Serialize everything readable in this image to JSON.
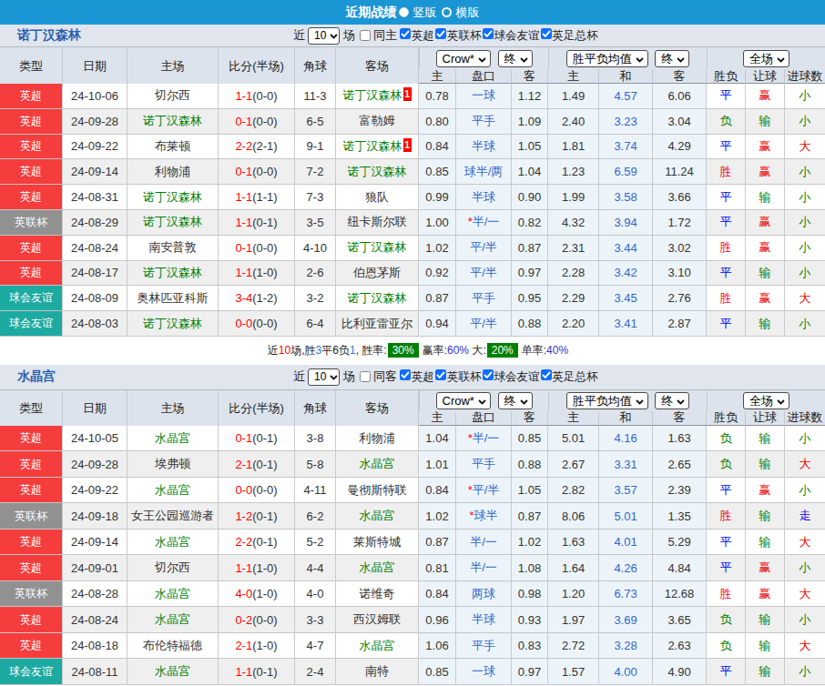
{
  "topbar": {
    "title": "近期战绩",
    "options": [
      {
        "label": "竖版",
        "selected": true
      },
      {
        "label": "横版",
        "selected": false
      }
    ]
  },
  "palette": {
    "topbar_blue": "#1b96d4",
    "league_red": "#f53d3d",
    "league_gray": "#919191",
    "league_teal": "#1caaa1",
    "focus_team_green": "#008000",
    "score_red": "#ff0000",
    "handicap_blue": "#3366cc",
    "summary_badge_green": "#008000"
  },
  "result_color_map": {
    "胜": "r",
    "赢": "r",
    "大": "r",
    "平": "b",
    "走": "b",
    "负": "g",
    "输": "g",
    "小": "g"
  },
  "league_bg_map": {
    "英超": "red",
    "英联杯": "gray",
    "球会友谊": "teal",
    "英足总杯": "teal"
  },
  "tables": [
    {
      "team": "诺丁汉森林",
      "filter": {
        "prefix": "近",
        "count": "10",
        "suffix": "场",
        "same_label": "同主",
        "same_checked": false,
        "leagues": [
          {
            "label": "英超",
            "checked": true
          },
          {
            "label": "英联杯",
            "checked": true
          },
          {
            "label": "球会友谊",
            "checked": true
          },
          {
            "label": "英足总杯",
            "checked": true
          }
        ]
      },
      "selects": {
        "company": "Crow*",
        "company_state": "终",
        "europe": "胜平负均值",
        "europe_state": "终",
        "scope": "全场"
      },
      "columns": [
        "类型",
        "日期",
        "主场",
        "比分(半场)",
        "角球",
        "客场",
        "主",
        "盘口",
        "客",
        "主",
        "和",
        "客",
        "胜负",
        "让球",
        "进球数"
      ],
      "rows": [
        {
          "comp": "英超",
          "date": "24-10-06",
          "home": "切尔西",
          "score": "1-1",
          "half": "(0-0)",
          "corner": "11-3",
          "away": "诺丁汉森林",
          "away_badge": "1",
          "ah": [
            "0.78",
            "一球",
            "1.12"
          ],
          "eu": [
            "1.49",
            "4.57",
            "6.06"
          ],
          "res": [
            "平",
            "赢",
            "小"
          ]
        },
        {
          "comp": "英超",
          "date": "24-09-28",
          "home": "诺丁汉森林",
          "score": "0-1",
          "half": "(0-0)",
          "corner": "6-5",
          "away": "富勒姆",
          "ah": [
            "0.80",
            "平手",
            "1.09"
          ],
          "eu": [
            "2.40",
            "3.23",
            "3.04"
          ],
          "res": [
            "负",
            "输",
            "小"
          ]
        },
        {
          "comp": "英超",
          "date": "24-09-22",
          "home": "布莱顿",
          "score": "2-2",
          "half": "(2-1)",
          "corner": "9-1",
          "away": "诺丁汉森林",
          "away_badge": "1",
          "ah": [
            "0.84",
            "半球",
            "1.05"
          ],
          "eu": [
            "1.81",
            "3.74",
            "4.29"
          ],
          "res": [
            "平",
            "赢",
            "大"
          ]
        },
        {
          "comp": "英超",
          "date": "24-09-14",
          "home": "利物浦",
          "score": "0-1",
          "half": "(0-0)",
          "corner": "7-2",
          "away": "诺丁汉森林",
          "ah": [
            "0.85",
            "球半/两",
            "1.04"
          ],
          "eu": [
            "1.23",
            "6.59",
            "11.24"
          ],
          "res": [
            "胜",
            "赢",
            "小"
          ]
        },
        {
          "comp": "英超",
          "date": "24-08-31",
          "home": "诺丁汉森林",
          "score": "1-1",
          "half": "(1-1)",
          "corner": "7-3",
          "away": "狼队",
          "ah": [
            "0.99",
            "半球",
            "0.90"
          ],
          "eu": [
            "1.99",
            "3.58",
            "3.66"
          ],
          "res": [
            "平",
            "输",
            "小"
          ]
        },
        {
          "comp": "英联杯",
          "date": "24-08-29",
          "home": "诺丁汉森林",
          "score": "1-1",
          "half": "(0-1)",
          "corner": "3-5",
          "away": "纽卡斯尔联",
          "ah": [
            "1.00",
            "*半/一",
            "0.82"
          ],
          "eu": [
            "4.32",
            "3.94",
            "1.72"
          ],
          "res": [
            "平",
            "赢",
            "小"
          ]
        },
        {
          "comp": "英超",
          "date": "24-08-24",
          "home": "南安普敦",
          "score": "0-1",
          "half": "(0-0)",
          "corner": "4-10",
          "away": "诺丁汉森林",
          "ah": [
            "1.02",
            "平/半",
            "0.87"
          ],
          "eu": [
            "2.31",
            "3.44",
            "3.02"
          ],
          "res": [
            "胜",
            "赢",
            "小"
          ]
        },
        {
          "comp": "英超",
          "date": "24-08-17",
          "home": "诺丁汉森林",
          "score": "1-1",
          "half": "(1-0)",
          "corner": "2-6",
          "away": "伯恩茅斯",
          "ah": [
            "0.92",
            "平/半",
            "0.97"
          ],
          "eu": [
            "2.28",
            "3.42",
            "3.10"
          ],
          "res": [
            "平",
            "输",
            "小"
          ]
        },
        {
          "comp": "球会友谊",
          "date": "24-08-09",
          "home": "奥林匹亚科斯",
          "score": "3-4",
          "half": "(1-2)",
          "corner": "3-2",
          "away": "诺丁汉森林",
          "ah": [
            "0.87",
            "平手",
            "0.95"
          ],
          "eu": [
            "2.29",
            "3.45",
            "2.76"
          ],
          "res": [
            "胜",
            "赢",
            "大"
          ]
        },
        {
          "comp": "球会友谊",
          "date": "24-08-03",
          "home": "诺丁汉森林",
          "score": "0-0",
          "half": "(0-0)",
          "corner": "6-4",
          "away": "比利亚雷亚尔",
          "ah": [
            "0.94",
            "平/半",
            "0.88"
          ],
          "eu": [
            "2.20",
            "3.41",
            "2.87"
          ],
          "res": [
            "平",
            "输",
            "小"
          ]
        }
      ],
      "summary": [
        {
          "text": "近"
        },
        {
          "text": "10",
          "style": "red"
        },
        {
          "text": "场,胜"
        },
        {
          "text": "3",
          "style": "blue"
        },
        {
          "text": "平"
        },
        {
          "text": "6"
        },
        {
          "text": "负"
        },
        {
          "text": "1",
          "style": "blue"
        },
        {
          "text": ", 胜率:"
        },
        {
          "text": "30%",
          "style": "badge"
        },
        {
          "text": "赢率:"
        },
        {
          "text": "60%",
          "style": "pct"
        },
        {
          "text": " 大:"
        },
        {
          "text": "20%",
          "style": "badge"
        },
        {
          "text": "单率:"
        },
        {
          "text": "40%",
          "style": "pct"
        }
      ]
    },
    {
      "team": "水晶宫",
      "filter": {
        "prefix": "近",
        "count": "10",
        "suffix": "场",
        "same_label": "同客",
        "same_checked": false,
        "leagues": [
          {
            "label": "英超",
            "checked": true
          },
          {
            "label": "英联杯",
            "checked": true
          },
          {
            "label": "球会友谊",
            "checked": true
          },
          {
            "label": "英足总杯",
            "checked": true
          }
        ]
      },
      "selects": {
        "company": "Crow*",
        "company_state": "终",
        "europe": "胜平负均值",
        "europe_state": "终",
        "scope": "全场"
      },
      "columns": [
        "类型",
        "日期",
        "主场",
        "比分(半场)",
        "角球",
        "客场",
        "主",
        "盘口",
        "客",
        "主",
        "和",
        "客",
        "胜负",
        "让球",
        "进球数"
      ],
      "rows": [
        {
          "comp": "英超",
          "date": "24-10-05",
          "home": "水晶宫",
          "score": "0-1",
          "half": "(0-1)",
          "corner": "3-8",
          "away": "利物浦",
          "ah": [
            "1.04",
            "*半/一",
            "0.85"
          ],
          "eu": [
            "5.01",
            "4.16",
            "1.63"
          ],
          "res": [
            "负",
            "输",
            "小"
          ]
        },
        {
          "comp": "英超",
          "date": "24-09-28",
          "home": "埃弗顿",
          "score": "2-1",
          "half": "(0-1)",
          "corner": "5-8",
          "away": "水晶宫",
          "ah": [
            "1.01",
            "平手",
            "0.88"
          ],
          "eu": [
            "2.67",
            "3.31",
            "2.65"
          ],
          "res": [
            "负",
            "输",
            "大"
          ]
        },
        {
          "comp": "英超",
          "date": "24-09-22",
          "home": "水晶宫",
          "score": "0-0",
          "half": "(0-0)",
          "corner": "4-11",
          "away": "曼彻斯特联",
          "ah": [
            "0.84",
            "*平/半",
            "1.05"
          ],
          "eu": [
            "2.82",
            "3.57",
            "2.39"
          ],
          "res": [
            "平",
            "赢",
            "小"
          ]
        },
        {
          "comp": "英联杯",
          "date": "24-09-18",
          "home": "女王公园巡游者",
          "score": "1-2",
          "half": "(0-1)",
          "corner": "6-2",
          "away": "水晶宫",
          "ah": [
            "1.02",
            "*球半",
            "0.87"
          ],
          "eu": [
            "8.06",
            "5.01",
            "1.35"
          ],
          "res": [
            "胜",
            "输",
            "走"
          ]
        },
        {
          "comp": "英超",
          "date": "24-09-14",
          "home": "水晶宫",
          "score": "2-2",
          "half": "(0-1)",
          "corner": "5-2",
          "away": "莱斯特城",
          "ah": [
            "0.87",
            "半/一",
            "1.02"
          ],
          "eu": [
            "1.63",
            "4.01",
            "5.29"
          ],
          "res": [
            "平",
            "输",
            "大"
          ]
        },
        {
          "comp": "英超",
          "date": "24-09-01",
          "home": "切尔西",
          "score": "1-1",
          "half": "(1-0)",
          "corner": "4-4",
          "away": "水晶宫",
          "ah": [
            "0.81",
            "半/一",
            "1.08"
          ],
          "eu": [
            "1.64",
            "4.26",
            "4.84"
          ],
          "res": [
            "平",
            "赢",
            "小"
          ]
        },
        {
          "comp": "英联杯",
          "date": "24-08-28",
          "home": "水晶宫",
          "score": "4-0",
          "half": "(1-0)",
          "corner": "4-0",
          "away": "诺维奇",
          "ah": [
            "0.84",
            "两球",
            "0.98"
          ],
          "eu": [
            "1.20",
            "6.73",
            "12.68"
          ],
          "res": [
            "胜",
            "赢",
            "大"
          ]
        },
        {
          "comp": "英超",
          "date": "24-08-24",
          "home": "水晶宫",
          "score": "0-2",
          "half": "(0-0)",
          "corner": "3-3",
          "away": "西汉姆联",
          "ah": [
            "0.96",
            "半球",
            "0.93"
          ],
          "eu": [
            "1.97",
            "3.69",
            "3.65"
          ],
          "res": [
            "负",
            "输",
            "小"
          ]
        },
        {
          "comp": "英超",
          "date": "24-08-18",
          "home": "布伦特福德",
          "score": "2-1",
          "half": "(1-0)",
          "corner": "4-7",
          "away": "水晶宫",
          "ah": [
            "1.06",
            "平手",
            "0.83"
          ],
          "eu": [
            "2.72",
            "3.28",
            "2.63"
          ],
          "res": [
            "负",
            "输",
            "大"
          ]
        },
        {
          "comp": "球会友谊",
          "date": "24-08-11",
          "home": "水晶宫",
          "score": "1-1",
          "half": "(0-1)",
          "corner": "2-4",
          "away": "南特",
          "ah": [
            "0.85",
            "一球",
            "0.97"
          ],
          "eu": [
            "1.57",
            "4.00",
            "4.90"
          ],
          "res": [
            "平",
            "输",
            "小"
          ]
        }
      ],
      "summary": null
    }
  ]
}
